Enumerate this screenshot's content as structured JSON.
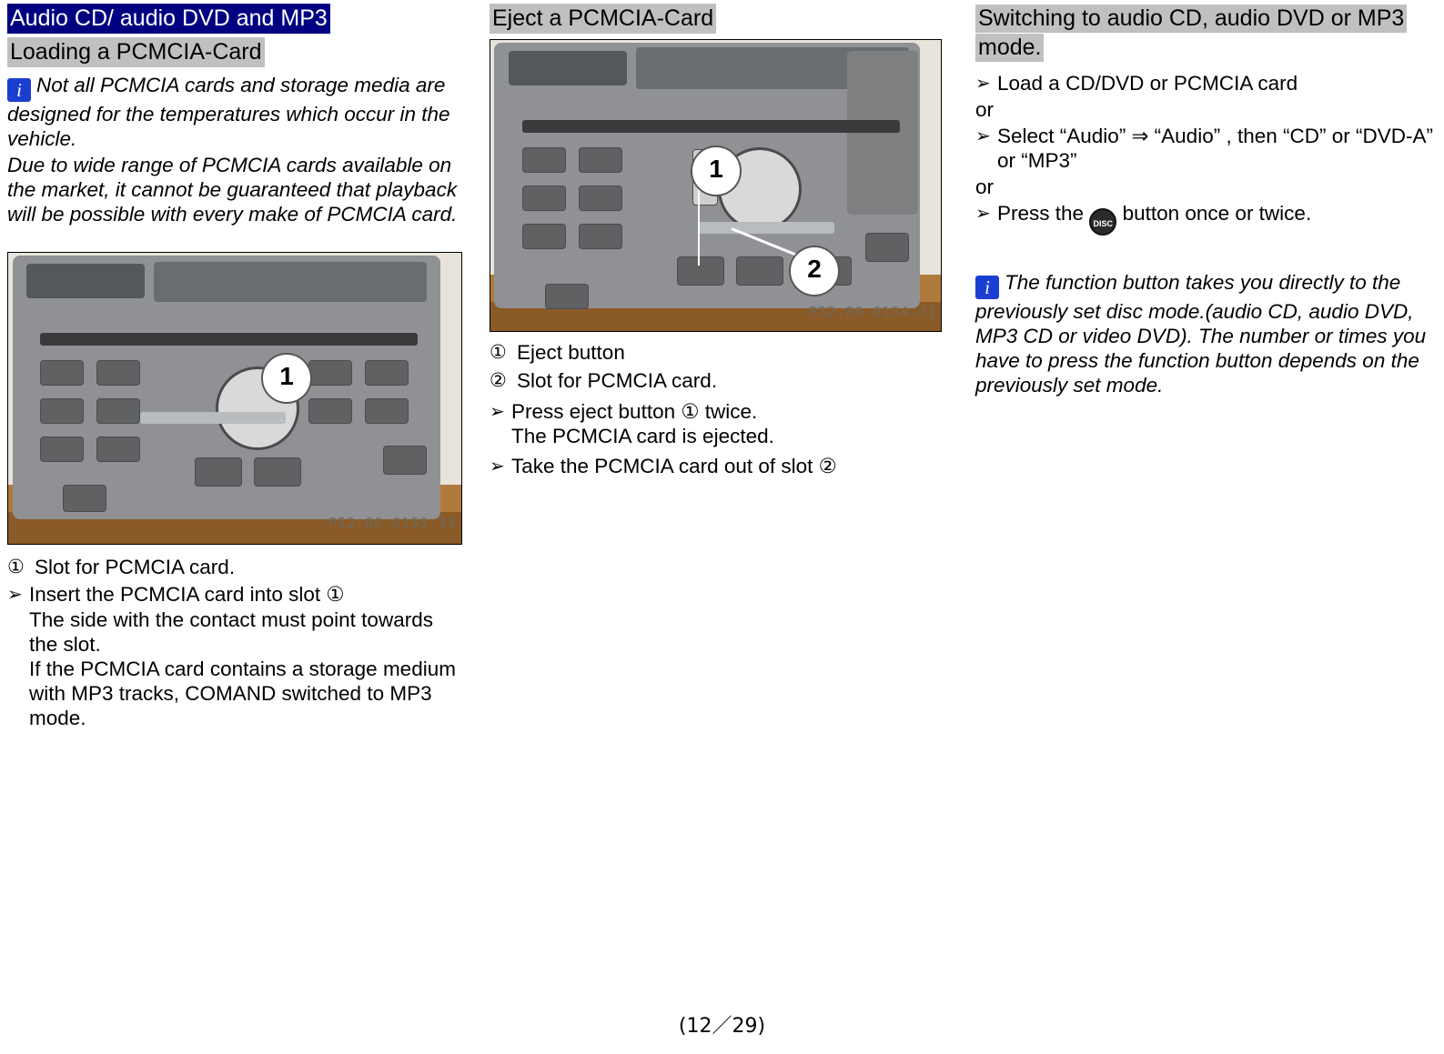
{
  "document": {
    "footer": "(12／29)"
  },
  "column1": {
    "title_blue": "Audio CD/ audio DVD and MP3",
    "title_gray": "Loading a PCMCIA-Card",
    "note": {
      "icon": "info-icon",
      "text_lead": "Not all PCMCIA   cards and storage media are designed for the temperatures which occur in the vehicle.",
      "text_body": "Due to wide range of PCMCIA cards available on the market, it cannot be guaranteed that playback will be possible with every make of PCMCIA card."
    },
    "figure": {
      "alt": "COMAND head unit faceplate with PCMCIA card slot",
      "callout_1": "1",
      "stamp": "P52.86-6153-31"
    },
    "legend_1": {
      "marker": "①",
      "text": "Slot for PCMCIA card."
    },
    "steps": [
      {
        "marker": "➢",
        "text": "Insert the PCMCIA  card into slot  ①",
        "sub": "The side with the contact must point towards the slot.\nIf the PCMCIA card contains a storage medium with MP3 tracks, COMAND switched to MP3 mode."
      }
    ]
  },
  "column2": {
    "title_gray": "Eject a PCMCIA-Card",
    "figure": {
      "alt": "COMAND head unit faceplate showing eject button and card slot",
      "callout_1": "1",
      "callout_2": "2",
      "stamp": "P52.86-6154-31"
    },
    "legend": [
      {
        "marker": "①",
        "text": "Eject button"
      },
      {
        "marker": "②",
        "text": "Slot for PCMCIA card."
      }
    ],
    "steps": [
      {
        "marker": "➢",
        "text": "Press eject button  ①  twice.",
        "sub": "The PCMCIA card is ejected."
      },
      {
        "marker": "➢",
        "text": "Take the PCMCIA card out of slot  ②",
        "sub": ""
      }
    ]
  },
  "column3": {
    "title_gray": "Switching to audio CD, audio DVD or MP3 mode.",
    "steps": [
      {
        "marker": "➢",
        "text": "Load a CD/DVD or PCMCIA card"
      },
      {
        "marker": "➢",
        "text": "Select “Audio”  ⇒  “Audio” , then “CD” or “DVD-A” or “MP3”"
      }
    ],
    "or_1": "or",
    "or_2": "or",
    "press_step": {
      "marker": "➢",
      "text_before": "Press the",
      "button_label": "DISC",
      "text_after": "button once or twice."
    },
    "note": {
      "icon": "info-icon",
      "text": "The function button takes you directly to the previously set disc mode.(audio CD, audio DVD, MP3 CD or video DVD). The number or times you have to press the function button depends on the previously set mode."
    }
  }
}
